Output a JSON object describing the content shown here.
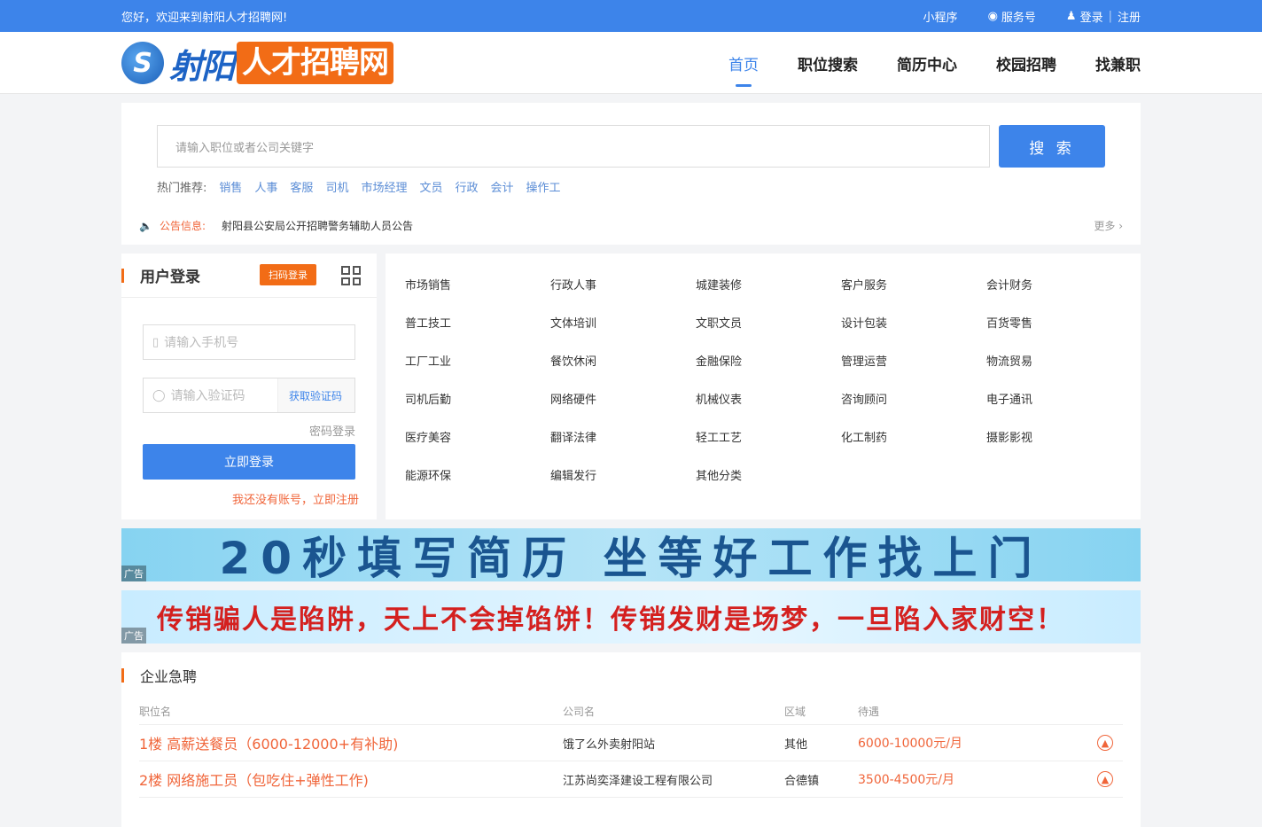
{
  "topbar": {
    "welcome": "您好，欢迎来到射阳人才招聘网!",
    "mini_program": "小程序",
    "service_account": "服务号",
    "login": "登录",
    "register": "注册"
  },
  "header": {
    "logo_city": "射阳",
    "logo_name": "人才招聘网",
    "nav": [
      {
        "label": "首页",
        "active": true
      },
      {
        "label": "职位搜索"
      },
      {
        "label": "简历中心"
      },
      {
        "label": "校园招聘"
      },
      {
        "label": "找兼职"
      }
    ]
  },
  "search": {
    "placeholder": "请输入职位或者公司关键字",
    "button": "搜 索",
    "hot_label": "热门推荐:",
    "hot_keywords": [
      "销售",
      "人事",
      "客服",
      "司机",
      "市场经理",
      "文员",
      "行政",
      "会计",
      "操作工"
    ]
  },
  "notice": {
    "label": "公告信息:",
    "text": "射阳县公安局公开招聘警务辅助人员公告",
    "more": "更多 ›"
  },
  "login": {
    "title": "用户登录",
    "qr_tag": "扫码登录",
    "phone_placeholder": "请输入手机号",
    "code_placeholder": "请输入验证码",
    "get_code": "获取验证码",
    "password_login": "密码登录",
    "submit": "立即登录",
    "register_link": "我还没有账号，立即注册"
  },
  "categories": [
    "市场销售",
    "行政人事",
    "城建装修",
    "客户服务",
    "会计财务",
    "普工技工",
    "文体培训",
    "文职文员",
    "设计包装",
    "百货零售",
    "工厂工业",
    "餐饮休闲",
    "金融保险",
    "管理运营",
    "物流贸易",
    "司机后勤",
    "网络硬件",
    "机械仪表",
    "咨询顾问",
    "电子通讯",
    "医疗美容",
    "翻译法律",
    "轻工工艺",
    "化工制药",
    "摄影影视",
    "能源环保",
    "编辑发行",
    "其他分类"
  ],
  "banners": {
    "banner1_text": "20秒填写简历 坐等好工作找上门",
    "banner2_text": "传销骗人是陷阱，天上不会掉馅饼！传销发财是场梦，一旦陷入家财空！",
    "ad_label": "广告"
  },
  "urgent": {
    "title": "企业急聘",
    "columns": [
      "职位名",
      "公司名",
      "区域",
      "待遇"
    ],
    "rows": [
      {
        "job": "1楼 高薪送餐员（6000-12000+有补助)",
        "company": "饿了么外卖射阳站",
        "area": "其他",
        "pay": "6000-10000元/月"
      },
      {
        "job": "2楼 网络施工员（包吃住+弹性工作)",
        "company": "江苏尚奕泽建设工程有限公司",
        "area": "合德镇",
        "pay": "3500-4500元/月"
      }
    ]
  },
  "colors": {
    "primary": "#3d84ea",
    "accent": "#f26c16",
    "link": "#f0653a"
  }
}
